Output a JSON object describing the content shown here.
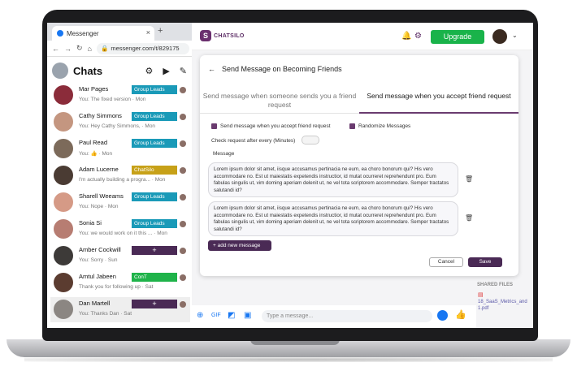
{
  "browser": {
    "tab_title": "Messenger",
    "tab_close": "×",
    "new_tab": "+",
    "url": "messenger.com/t/829175"
  },
  "sidebar": {
    "title": "Chats",
    "conversations": [
      {
        "name": "Mar Pages",
        "snippet": "You: The fixed version · Mon",
        "tag": "Group Leads",
        "tag_color": "#1a9ab8",
        "avatar_color": "#8b2c3a"
      },
      {
        "name": "Cathy Simmons",
        "snippet": "You: Hey Cathy Simmons, · Mon",
        "tag": "Group Leads",
        "tag_color": "#1a9ab8",
        "avatar_color": "#c49680"
      },
      {
        "name": "Paul Read",
        "snippet": "You: 👍 · Mon",
        "tag": "Group Leads",
        "tag_color": "#1a9ab8",
        "avatar_color": "#7c6a5a"
      },
      {
        "name": "Adam Lucerne",
        "snippet": "I'm actually building a progra... · Mon",
        "tag": "ChatSilo",
        "tag_color": "#c7a118",
        "avatar_color": "#4a3b33"
      },
      {
        "name": "Sharell Weeams",
        "snippet": "You: Nope · Mon",
        "tag": "Group Leads",
        "tag_color": "#1a9ab8",
        "avatar_color": "#d59a86"
      },
      {
        "name": "Sonia Si",
        "snippet": "You: we would work on it this ... · Mon",
        "tag": "Group Leads",
        "tag_color": "#1a9ab8",
        "avatar_color": "#b77d72"
      },
      {
        "name": "Amber Cockwill",
        "snippet": "You: Sorry · Sun",
        "tag": "+",
        "tag_color": "#4a2a55",
        "avatar_color": "#3d3a38"
      },
      {
        "name": "Amtul Jabeen",
        "snippet": "Thank you for following up · Sat",
        "tag": "ConT",
        "tag_color": "#1fb34a",
        "avatar_color": "#5b3c30"
      },
      {
        "name": "Dan Martell",
        "snippet": "You: Thanks Dan · Sat",
        "tag": "+",
        "tag_color": "#4a2a55",
        "avatar_color": "#8b8682"
      }
    ]
  },
  "header": {
    "logo_text": "CHATSILO",
    "upgrade_label": "Upgrade"
  },
  "modal": {
    "title": "Send Message on Becoming Friends",
    "tabs": [
      {
        "label": "Send message when someone sends you a friend request",
        "active": false
      },
      {
        "label": "Send message when you accept friend request",
        "active": true
      }
    ],
    "checkbox_accept": "Send message when you accept friend request",
    "checkbox_randomize": "Randomize Messages",
    "check_every_label": "Check request after every (Minutes)",
    "message_label": "Message",
    "messages": [
      "Lorem ipsum dolor sit amet, iisque accusamus pertinacia ne eum, ea choro bonorum qui? His vero accommodare no. Est ut maiestatis expetendis instructior, id mutat ocurreret reprehendunt pro. Eum fabulas singulis ut, vim doming aperiam delenit ut, ne vel tota scriptorem accommodare. Semper tractatos salutandi id?",
      "Lorem ipsum dolor sit amet, iisque accusamus pertinacia ne eum, ea choro bonorum qui? His vero accommodare no. Est ut maiestatis expetendis instructior, id mutat ocurreret reprehendunt pro. Eum fabulas singulis ut, vim doming aperiam delenit ut, ne vel tota scriptorem accommodare. Semper tractatos salutandi id?"
    ],
    "add_message_label": "+ add new message",
    "cancel_label": "Cancel",
    "save_label": "Save"
  },
  "composer": {
    "placeholder": "Type a message..."
  },
  "shared_files": {
    "label": "SHARED FILES",
    "file_name": "18_SaaS_Metrics_and 1.pdf"
  }
}
